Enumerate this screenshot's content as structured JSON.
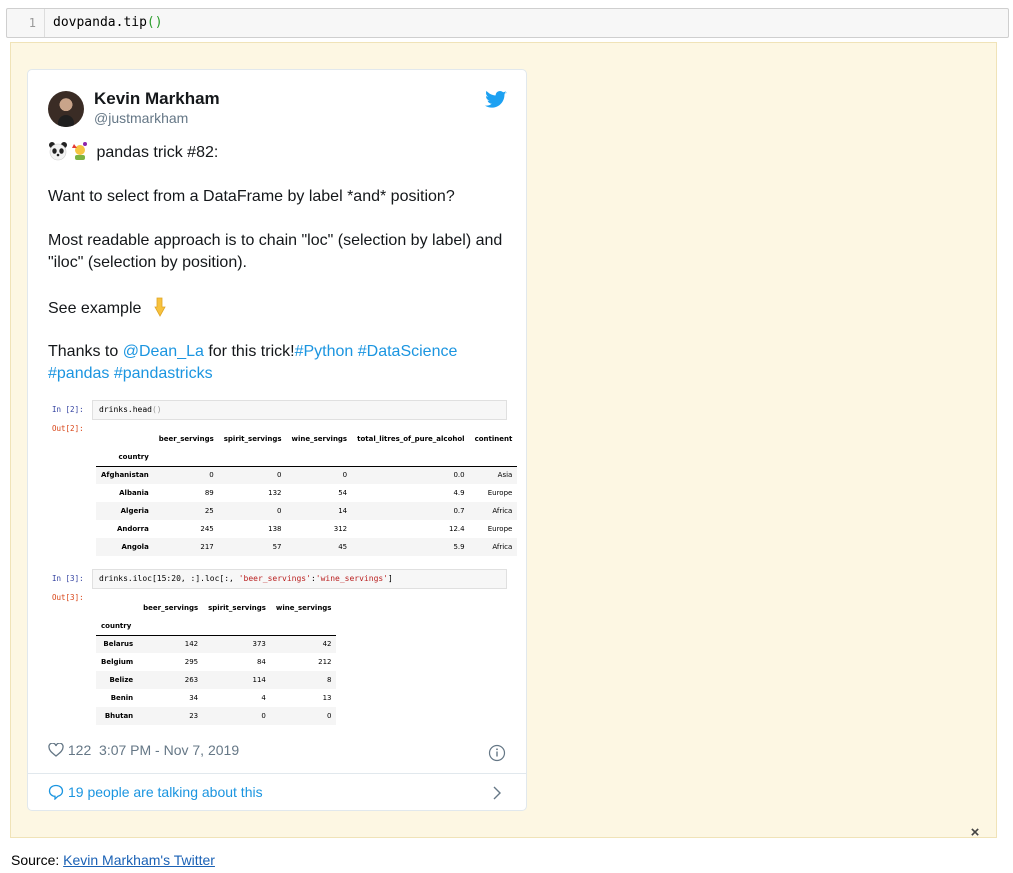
{
  "code_cell": {
    "line_number": "1",
    "code_prefix": "dovpanda.tip",
    "code_parens": "()"
  },
  "tweet": {
    "author_name": "Kevin Markham",
    "author_handle": "@justmarkham",
    "line_trick": "pandas trick #82:",
    "line_question": "Want to select from a DataFrame by label *and* position?",
    "line_approach": "Most readable approach is to chain \"loc\" (selection by label) and \"iloc\" (selection by position).",
    "line_see": "See example",
    "thanks_prefix": "Thanks to ",
    "thanks_mention": "@Dean_La",
    "thanks_middle": " for this trick!",
    "hashtag_python": "#Python",
    "hashtag_datascience": "#DataScience",
    "hashtag_pandas": "#pandas",
    "hashtag_pandastricks": "#pandastricks",
    "likes": "122",
    "timestamp": "3:07 PM - Nov 7, 2019",
    "talking": "19 people are talking about this",
    "link_color": "#1b95e0"
  },
  "notebook": {
    "in2_prompt": "In [2]:",
    "in2_code_prefix": "drinks.head",
    "in2_code_parens": "()",
    "out2_prompt": "Out[2]:",
    "table1": {
      "columns": [
        "beer_servings",
        "spirit_servings",
        "wine_servings",
        "total_litres_of_pure_alcohol",
        "continent"
      ],
      "index_name": "country",
      "rows": [
        {
          "country": "Afghanistan",
          "values": [
            "0",
            "0",
            "0",
            "0.0",
            "Asia"
          ]
        },
        {
          "country": "Albania",
          "values": [
            "89",
            "132",
            "54",
            "4.9",
            "Europe"
          ]
        },
        {
          "country": "Algeria",
          "values": [
            "25",
            "0",
            "14",
            "0.7",
            "Africa"
          ]
        },
        {
          "country": "Andorra",
          "values": [
            "245",
            "138",
            "312",
            "12.4",
            "Europe"
          ]
        },
        {
          "country": "Angola",
          "values": [
            "217",
            "57",
            "45",
            "5.9",
            "Africa"
          ]
        }
      ]
    },
    "in3_prompt": "In [3]:",
    "in3_code_a": "drinks.iloc[15:20, :].loc[:, ",
    "in3_code_str1": "'beer_servings'",
    "in3_code_colon": ":",
    "in3_code_str2": "'wine_servings'",
    "in3_code_end": "]",
    "out3_prompt": "Out[3]:",
    "table2": {
      "columns": [
        "beer_servings",
        "spirit_servings",
        "wine_servings"
      ],
      "index_name": "country",
      "rows": [
        {
          "country": "Belarus",
          "values": [
            "142",
            "373",
            "42"
          ]
        },
        {
          "country": "Belgium",
          "values": [
            "295",
            "84",
            "212"
          ]
        },
        {
          "country": "Belize",
          "values": [
            "263",
            "114",
            "8"
          ]
        },
        {
          "country": "Benin",
          "values": [
            "34",
            "4",
            "13"
          ]
        },
        {
          "country": "Bhutan",
          "values": [
            "23",
            "0",
            "0"
          ]
        }
      ]
    }
  },
  "close_label": "×",
  "source": {
    "prefix": "Source: ",
    "link_text": "Kevin Markham's Twitter"
  },
  "icons": [
    "avatar",
    "twitter-bird-icon",
    "panda-emoji-icon",
    "party-emoji-icon",
    "pointing-down-emoji-icon",
    "heart-icon",
    "info-icon",
    "speech-bubble-icon",
    "chevron-right-icon",
    "close-icon"
  ]
}
